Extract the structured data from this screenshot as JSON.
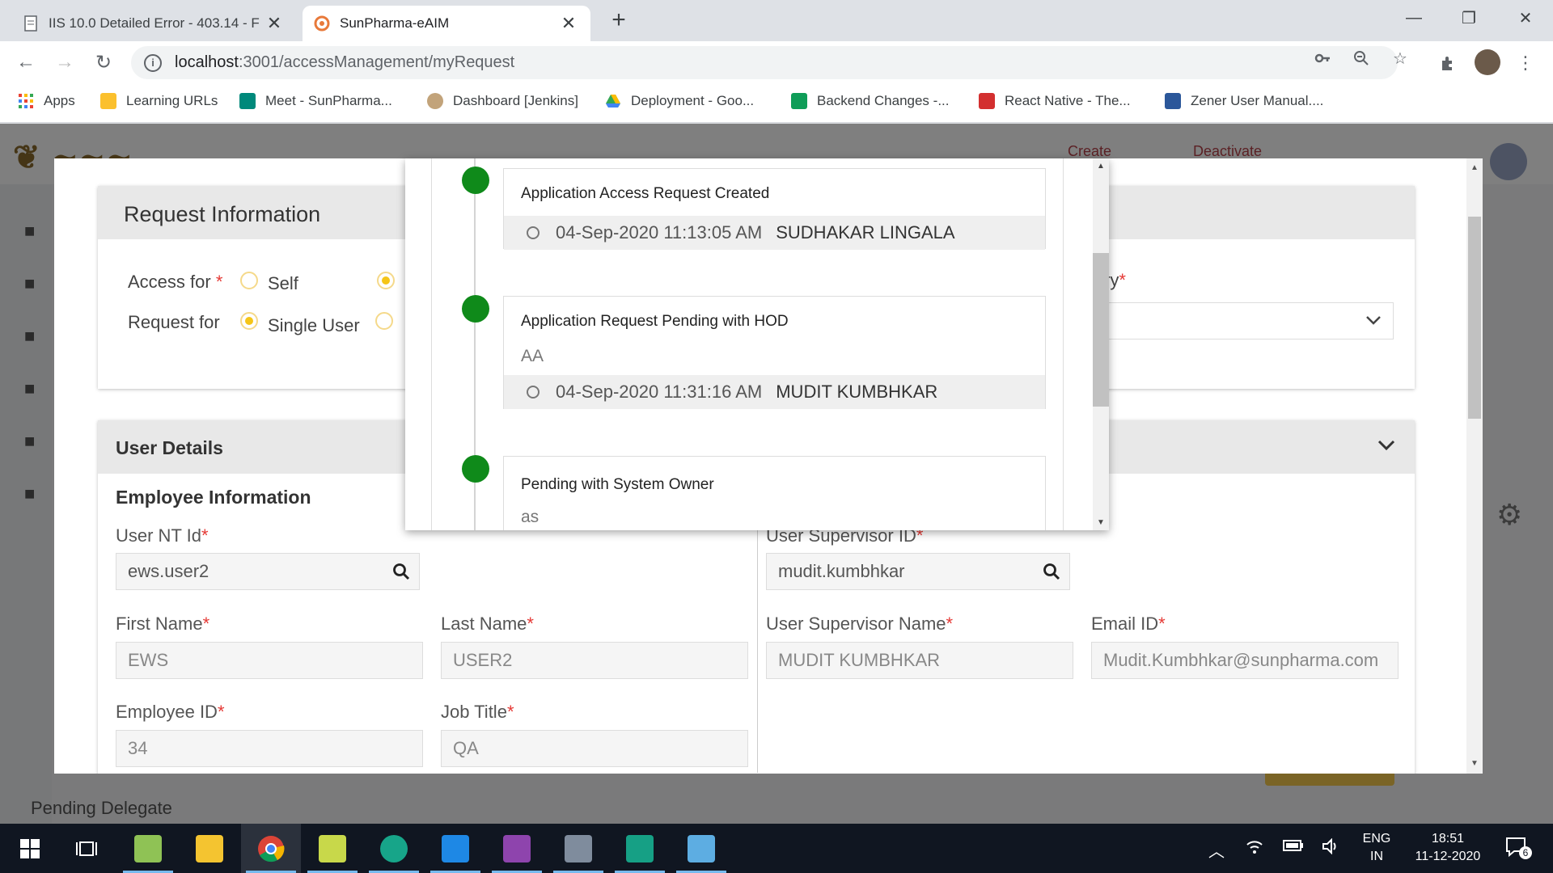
{
  "browser": {
    "tabs": [
      {
        "title": "IIS 10.0 Detailed Error - 403.14 - F",
        "active": false
      },
      {
        "title": "SunPharma-eAIM",
        "active": true
      }
    ],
    "url_host": "localhost",
    "url_path": ":3001/accessManagement/myRequest",
    "bookmarks": [
      {
        "label": "Apps",
        "color": "#ea4335"
      },
      {
        "label": "Learning URLs",
        "color": "#fbc02d"
      },
      {
        "label": "Meet - SunPharma...",
        "color": "#00897b"
      },
      {
        "label": "Dashboard [Jenkins]",
        "color": "#c2a37a"
      },
      {
        "label": "Deployment - Goo...",
        "color": "#34a853"
      },
      {
        "label": "Backend Changes -...",
        "color": "#0f9d58"
      },
      {
        "label": "React Native - The...",
        "color": "#d32f2f"
      },
      {
        "label": "Zener User Manual....",
        "color": "#2b579a"
      }
    ]
  },
  "background": {
    "header_links": [
      "Create",
      "Deactivate"
    ],
    "pending_delegate": "Pending Delegate"
  },
  "modal": {
    "request_info": {
      "title": "Request Information",
      "access_for_label": "Access for",
      "access_for_options": [
        "Self",
        ""
      ],
      "access_for_selected": 1,
      "request_for_label": "Request for",
      "request_for_options": [
        "Single User",
        ""
      ],
      "request_for_selected": 0,
      "partial_right_label": "ry",
      "required_mark": "*"
    },
    "user_details": {
      "title": "User Details",
      "employee_info_title": "Employee Information",
      "fields": {
        "user_nt_id": {
          "label": "User NT Id",
          "value": "ews.user2"
        },
        "user_supervisor_id": {
          "label": "User Supervisor ID",
          "value": "mudit.kumbhkar"
        },
        "first_name": {
          "label": "First Name",
          "value": "EWS"
        },
        "last_name": {
          "label": "Last Name",
          "value": "USER2"
        },
        "user_supervisor_name": {
          "label": "User Supervisor Name",
          "value": "MUDIT KUMBHKAR"
        },
        "email_id": {
          "label": "Email ID",
          "value": "Mudit.Kumbhkar@sunpharma.com"
        },
        "employee_id": {
          "label": "Employee ID",
          "value": "34"
        },
        "job_title": {
          "label": "Job Title",
          "value": "QA"
        }
      }
    }
  },
  "timeline": {
    "status_color": "#0f8a1a",
    "events": [
      {
        "title": "Application Access Request Created",
        "note": "",
        "datetime": "04-Sep-2020 11:13:05 AM",
        "user": "SUDHAKAR LINGALA"
      },
      {
        "title": "Application Request Pending with HOD",
        "note": "AA",
        "datetime": "04-Sep-2020 11:31:16 AM",
        "user": "MUDIT KUMBHKAR"
      },
      {
        "title": "Pending with System Owner",
        "note": "as",
        "datetime": "",
        "user": ""
      }
    ]
  },
  "taskbar": {
    "lang_line1": "ENG",
    "lang_line2": "IN",
    "time": "18:51",
    "date": "11-12-2020",
    "notification_count": "6"
  }
}
